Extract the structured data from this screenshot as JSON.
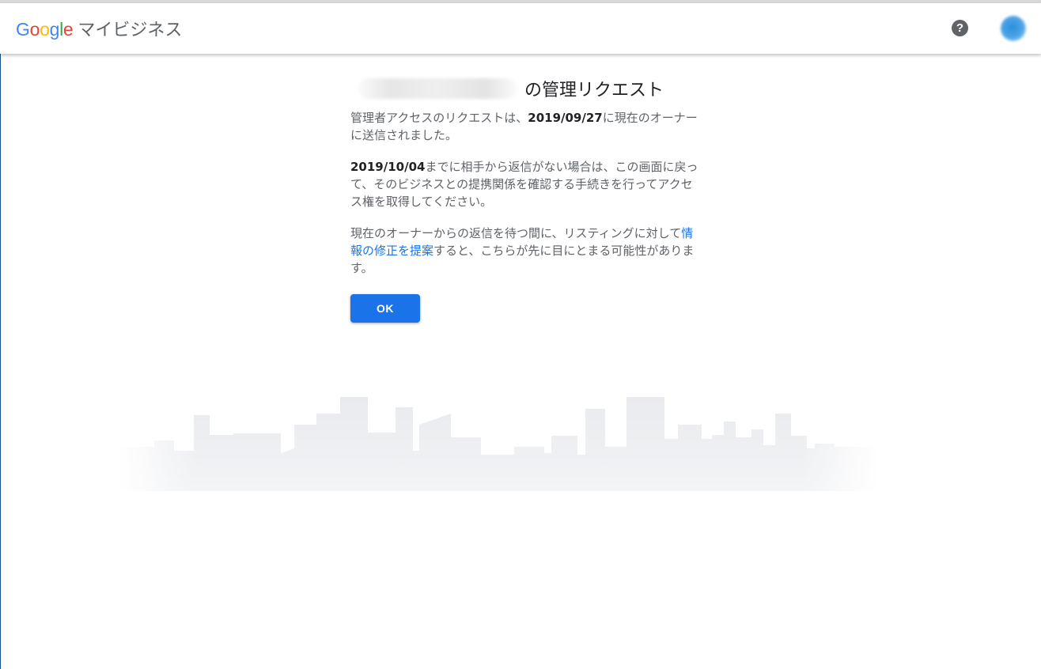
{
  "header": {
    "logo_letters": [
      {
        "char": "G",
        "color": "#4285F4"
      },
      {
        "char": "o",
        "color": "#EA4335"
      },
      {
        "char": "o",
        "color": "#FBBC05"
      },
      {
        "char": "g",
        "color": "#4285F4"
      },
      {
        "char": "l",
        "color": "#34A853"
      },
      {
        "char": "e",
        "color": "#EA4335"
      }
    ],
    "product_name": "マイビジネス",
    "help_icon": "help-circle-icon",
    "help_glyph": "?",
    "avatar_icon": "account-avatar"
  },
  "page": {
    "title_suffix": "の管理リクエスト",
    "p1_before": "管理者アクセスのリクエストは、",
    "p1_date": "2019/09/27",
    "p1_after": "に現在のオーナーに送信されました。",
    "p2_date": "2019/10/04",
    "p2_after": "までに相手から返信がない場合は、この画面に戻って、そのビジネスとの提携関係を確認する手続きを行ってアクセス権を取得してください。",
    "p3_before": "現在のオーナーからの返信を待つ間に、リスティングに対して",
    "p3_link": "情報の修正を提案",
    "p3_after": "すると、こちらが先に目にとまる可能性があります。",
    "ok_label": "OK"
  },
  "colors": {
    "accent": "#1a73e8",
    "skyline": "#e8e9ec"
  }
}
